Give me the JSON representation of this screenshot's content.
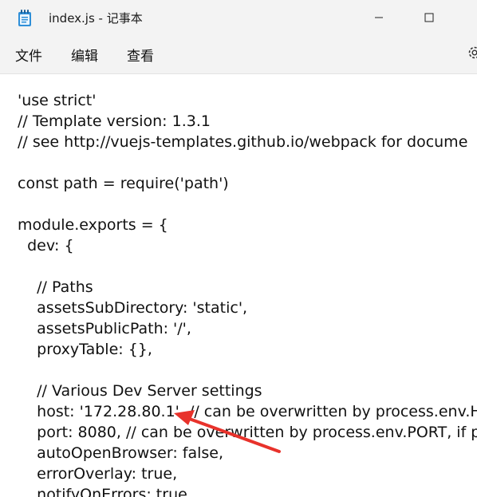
{
  "window": {
    "title": "index.js - 记事本",
    "app_icon": "notepad-icon",
    "controls": [
      "minimize-icon",
      "maximize-icon"
    ]
  },
  "menu": {
    "file": "文件",
    "edit": "编辑",
    "view": "查看",
    "settings_icon": "gear-icon"
  },
  "editor": {
    "lines": [
      "'use strict'",
      "// Template version: 1.3.1",
      "// see http://vuejs-templates.github.io/webpack for docume",
      "",
      "const path = require('path')",
      "",
      "module.exports = {",
      "  dev: {",
      "",
      "    // Paths",
      "    assetsSubDirectory: 'static',",
      "    assetsPublicPath: '/',",
      "    proxyTable: {},",
      "",
      "    // Various Dev Server settings",
      "    host: '172.28.80.1', // can be overwritten by process.env.H",
      "    port: 8080, // can be overwritten by process.env.PORT, if p",
      "    autoOpenBrowser: false,",
      "    errorOverlay: true,",
      "    notifyOnErrors: true"
    ]
  },
  "annotation": {
    "color": "#e8322b",
    "icon": "red-arrow-annotation"
  }
}
